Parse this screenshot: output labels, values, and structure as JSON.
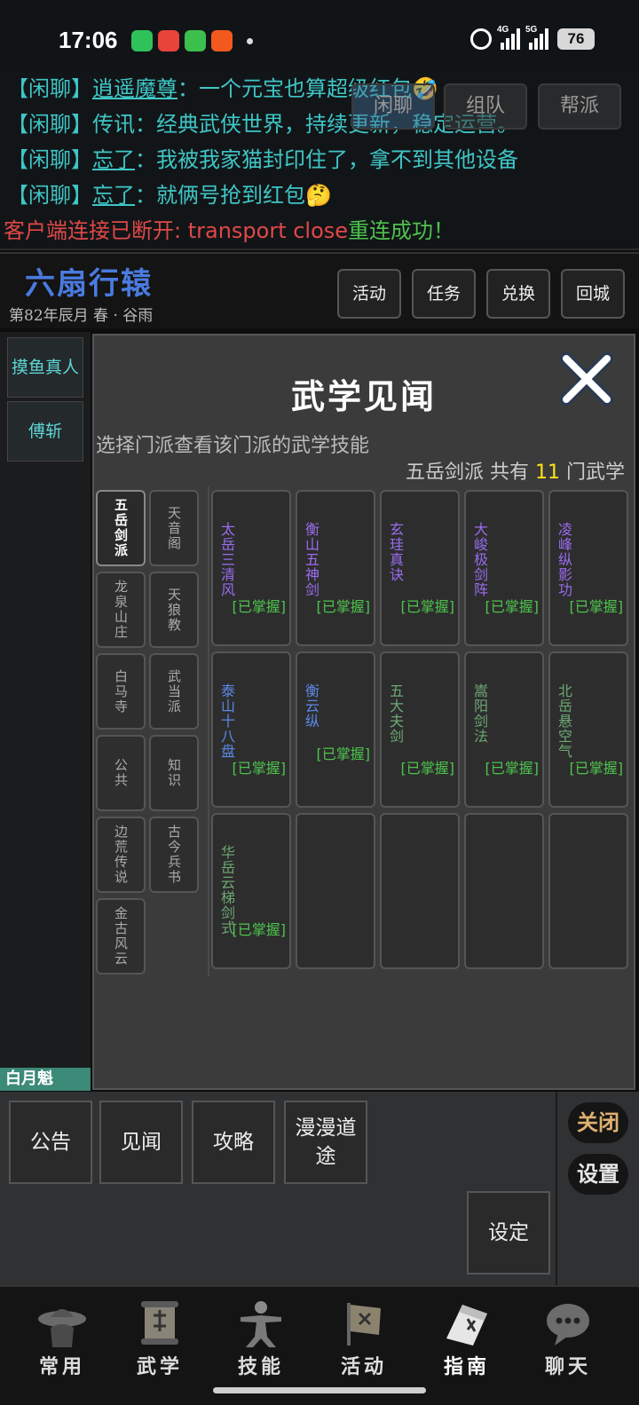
{
  "status": {
    "time": "17:06",
    "battery": "76",
    "net1": "4G",
    "net2": "5G"
  },
  "chat": {
    "lines": [
      {
        "channel": "【闲聊】",
        "who": "逍遥魔尊",
        "text": "：一个元宝也算超级红包🤣"
      },
      {
        "channel": "【闲聊】",
        "who": "传讯",
        "text": "：经典武侠世界，持续更新，稳定运营。"
      },
      {
        "channel": "【闲聊】",
        "who": "忘了",
        "text": "：我被我家猫封印住了，拿不到其他设备"
      },
      {
        "channel": "【闲聊】",
        "who": "忘了",
        "text": "：就俩号抢到红包🤔"
      }
    ],
    "error": "客户端连接已断开: transport close",
    "reconnect": "重连成功！",
    "tabs": [
      "闲聊",
      "组队",
      "帮派"
    ]
  },
  "header": {
    "location": "六扇行辕",
    "date": "第82年辰月  春 · 谷雨",
    "buttons": [
      "活动",
      "任务",
      "兑换",
      "回城"
    ]
  },
  "sidebar": {
    "items": [
      "摸鱼真人",
      "傅斩"
    ],
    "player": "白月魁"
  },
  "panel": {
    "title": "武学见闻",
    "hint": "选择门派查看该门派的武学技能",
    "count_prefix": "五岳剑派 共有 ",
    "count": "11",
    "count_suffix": " 门武学",
    "sects": [
      "五岳剑派",
      "天音阁",
      "龙泉山庄",
      "天狼教",
      "白马寺",
      "武当派",
      "公共",
      "知识",
      "边荒传说",
      "古今兵书",
      "金古风云"
    ],
    "skills": [
      {
        "name": "太岳三清风",
        "status": "[已掌握]",
        "color": "#9a6cf0"
      },
      {
        "name": "衡山五神剑",
        "status": "[已掌握]",
        "color": "#9a6cf0"
      },
      {
        "name": "玄珪真诀",
        "status": "[已掌握]",
        "color": "#9a6cf0"
      },
      {
        "name": "大峻极剑阵",
        "status": "[已掌握]",
        "color": "#9a6cf0"
      },
      {
        "name": "凌峰纵影功",
        "status": "[已掌握]",
        "color": "#9a6cf0"
      },
      {
        "name": "泰山十八盘",
        "status": "[已掌握]",
        "color": "#5b89e8"
      },
      {
        "name": "衡云纵",
        "status": "[已掌握]",
        "color": "#5b89e8"
      },
      {
        "name": "五大夫剑",
        "status": "[已掌握]",
        "color": "#6da874"
      },
      {
        "name": "嵩阳剑法",
        "status": "[已掌握]",
        "color": "#6da874"
      },
      {
        "name": "北岳悬空气",
        "status": "[已掌握]",
        "color": "#6da874"
      },
      {
        "name": "华岳云梯剑式",
        "status": "[已掌握]",
        "color": "#6da874"
      }
    ]
  },
  "bottom": {
    "buttons": [
      "公告",
      "见闻",
      "攻略",
      "漫漫道途"
    ],
    "settings_btn": "设定",
    "close": "关闭",
    "settings": "设置"
  },
  "nav": {
    "items": [
      {
        "label": "常用",
        "icon": "hat-icon"
      },
      {
        "label": "武学",
        "icon": "scroll-icon"
      },
      {
        "label": "技能",
        "icon": "martial-figure-icon"
      },
      {
        "label": "活动",
        "icon": "banner-icon"
      },
      {
        "label": "指南",
        "icon": "book-icon"
      },
      {
        "label": "聊天",
        "icon": "chat-bubble-icon"
      }
    ]
  }
}
